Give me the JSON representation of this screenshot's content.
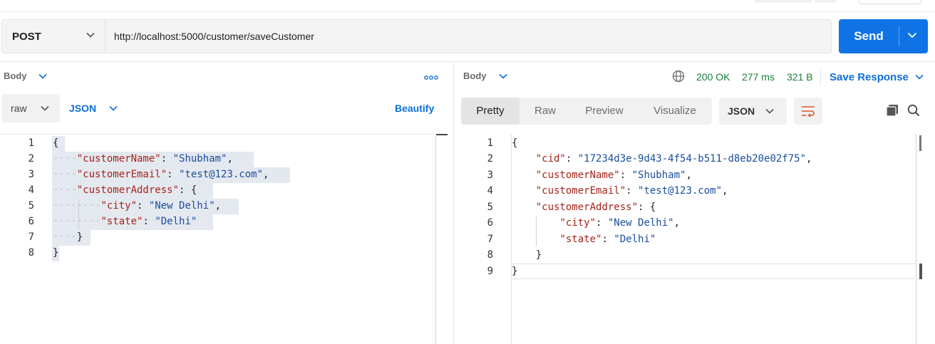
{
  "request": {
    "method": "POST",
    "url": "http://localhost:5000/customer/saveCustomer",
    "send_label": "Send"
  },
  "left": {
    "section_label": "Body",
    "mode": "raw",
    "format": "JSON",
    "beautify_label": "Beautify",
    "line_numbers": [
      "1",
      "2",
      "3",
      "4",
      "5",
      "6",
      "7",
      "8"
    ]
  },
  "right": {
    "section_label": "Body",
    "status": "200 OK",
    "time": "277 ms",
    "size": "321 B",
    "save_response_label": "Save Response",
    "tabs": [
      "Pretty",
      "Raw",
      "Preview",
      "Visualize"
    ],
    "format": "JSON",
    "line_numbers": [
      "1",
      "2",
      "3",
      "4",
      "5",
      "6",
      "7",
      "8",
      "9"
    ]
  },
  "body_json": {
    "k_name": "\"customerName\"",
    "v_name": "\"Shubham\"",
    "k_email": "\"customerEmail\"",
    "v_email": "\"test@123.com\"",
    "k_address": "\"customerAddress\"",
    "k_city": "\"city\"",
    "v_city": "\"New Delhi\"",
    "k_state": "\"state\"",
    "v_state": "\"Delhi\""
  },
  "response_json": {
    "k_cid": "\"cid\"",
    "v_cid": "\"17234d3e-9d43-4f54-b511-d8eb20e02f75\"",
    "k_name": "\"customerName\"",
    "v_name": "\"Shubham\"",
    "k_email": "\"customerEmail\"",
    "v_email": "\"test@123.com\"",
    "k_address": "\"customerAddress\"",
    "k_city": "\"city\"",
    "v_city": "\"New Delhi\"",
    "k_state": "\"state\"",
    "v_state": "\"Delhi\""
  },
  "colors": {
    "send": "#0f73e6",
    "status_ok": "#1a7f37",
    "json_key": "#a3251a",
    "json_string": "#1a4d9c",
    "wrap_icon": "#e0552b"
  },
  "icons": [
    "chevron-down-icon",
    "more-options-icon",
    "globe-icon",
    "wrap-lines-icon",
    "copy-icon",
    "search-icon"
  ]
}
